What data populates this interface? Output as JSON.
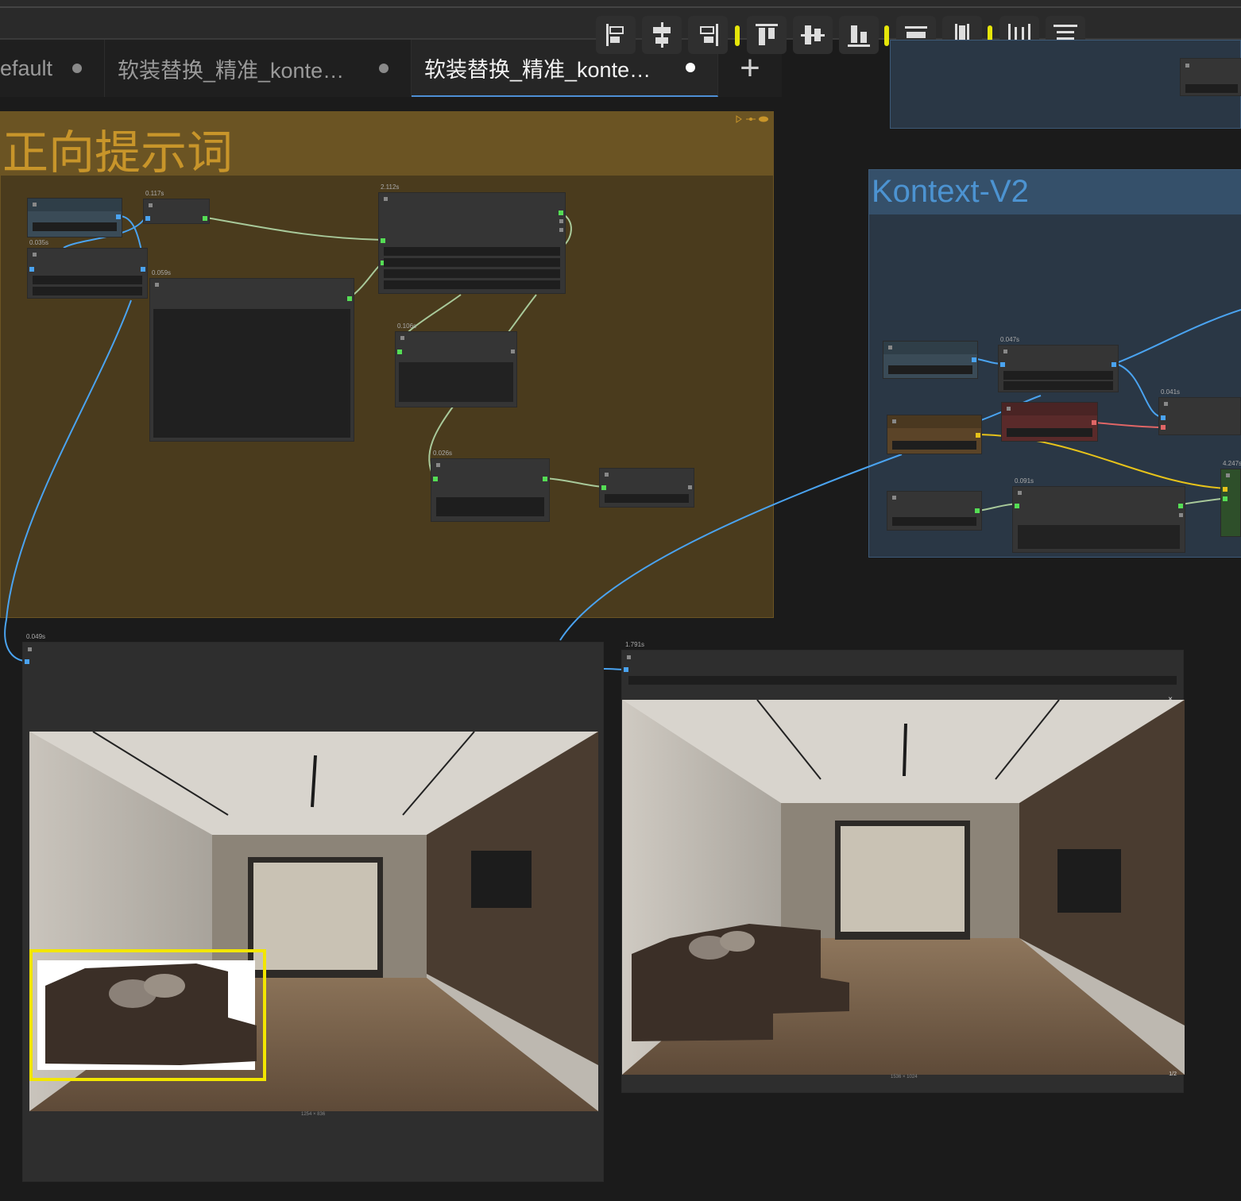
{
  "tabs": [
    {
      "label": "efault",
      "active": false
    },
    {
      "label": "软装替换_精准_konte…",
      "active": false
    },
    {
      "label": "软装替换_精准_konte…",
      "active": true
    }
  ],
  "tab_add_label": "+",
  "toolbar_icons": [
    "align-left-icon",
    "align-center-h-icon",
    "align-right-icon",
    "align-top-icon",
    "align-middle-v-icon",
    "align-bottom-icon",
    "distribute-h-icon",
    "distribute-v-icon",
    "distribute-edges-h-icon",
    "distribute-edges-v-icon"
  ],
  "groups": {
    "prompt": {
      "title": "正向提示词",
      "color": "#6b5423"
    },
    "kontext": {
      "title": "Kontext-V2",
      "color": "#35506a"
    }
  },
  "node_timings": {
    "n1": "0.035s",
    "n2": "0.117s",
    "n3": "0.059s",
    "n4": "2.112s",
    "n5": "0.106s",
    "n6": "0.026s",
    "k1": "0.047s",
    "k2": "0.041s",
    "k3": "0.091s",
    "k4": "4.247s",
    "img_left": "0.049s",
    "img_right": "1.791s"
  },
  "images": {
    "left_caption": "1254 × 836",
    "right_caption": "1536 × 1024",
    "right_pager": "1/2",
    "right_close": "×"
  },
  "colors": {
    "accent": "#4e8fd6",
    "wire_blue": "#4aa3f0",
    "wire_yellow": "#e6c21a",
    "wire_red": "#e06666",
    "wire_green": "#a8c99a"
  }
}
